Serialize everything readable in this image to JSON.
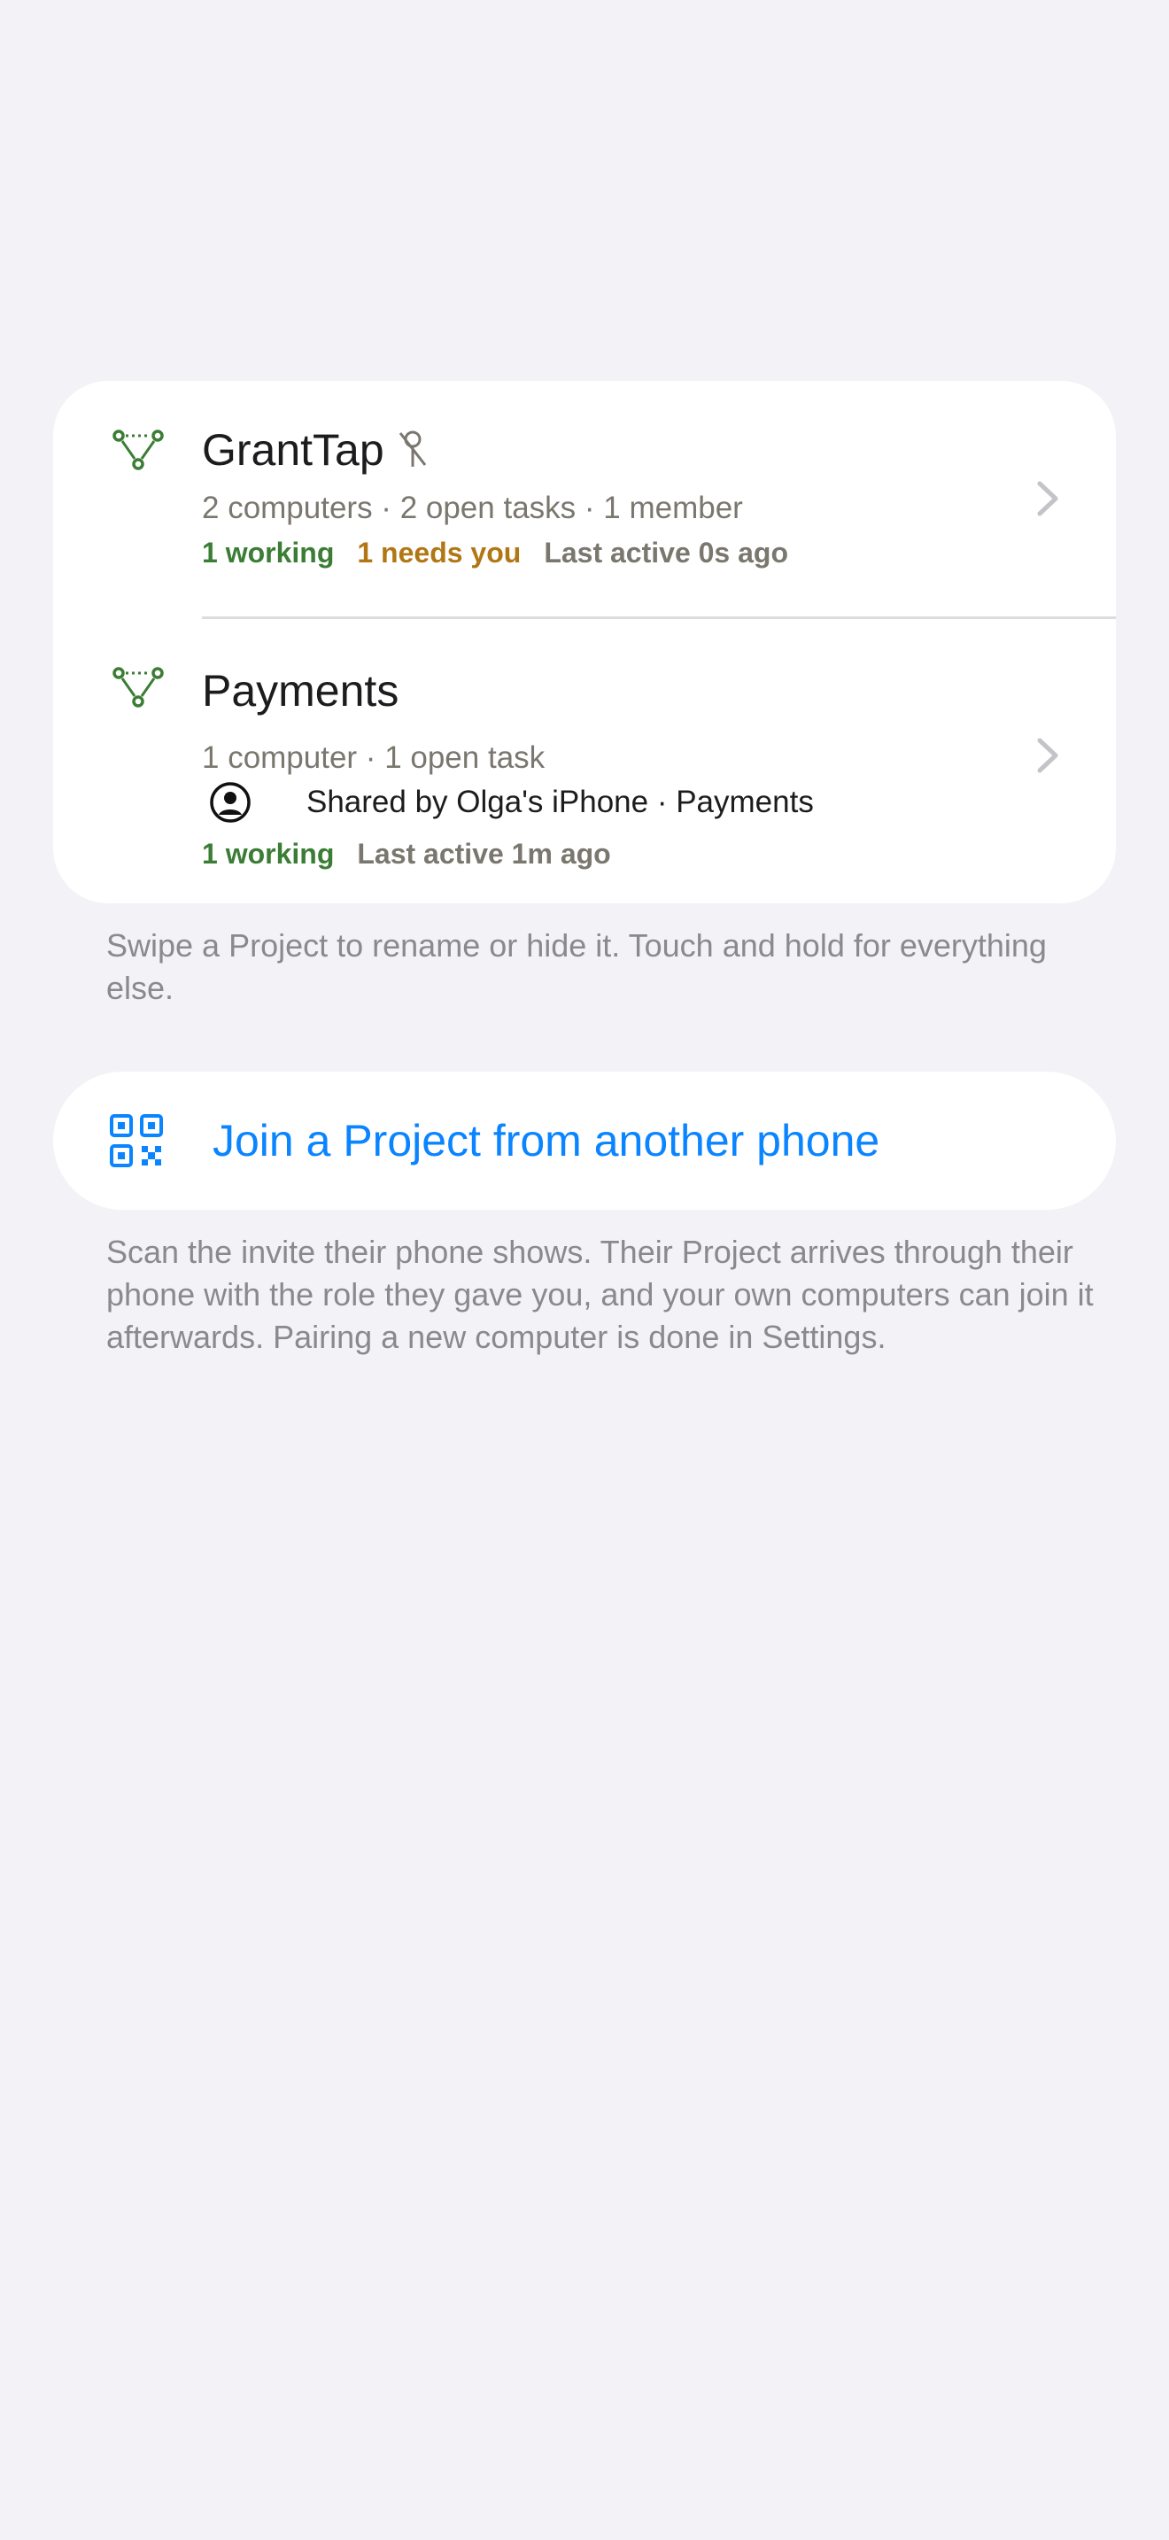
{
  "projects": [
    {
      "title": "GrantTap",
      "meta": "2 computers · 2 open tasks · 1 member",
      "status_working": "1 working",
      "status_needs": "1 needs you",
      "last_active": "Last active 0s ago",
      "icon": "project-network-icon",
      "pinned_icon": "pin-slash-icon"
    },
    {
      "title": "Payments",
      "meta": "1 computer · 1 open task",
      "shared": "Shared by Olga's iPhone · Payments",
      "status_working": "1 working",
      "last_active": "Last active 1m ago",
      "icon": "project-network-icon"
    }
  ],
  "projects_footnote": "Swipe a Project to rename or hide it. Touch and hold for everything else.",
  "join": {
    "label": "Join a Project from another phone",
    "icon": "qr-code-icon"
  },
  "join_footnote": "Scan the invite their phone shows. Their Project arrives through their phone with the role they gave you, and your own computers can join it afterwards. Pairing a new computer is done in Settings.",
  "colors": {
    "background": "#f2f2f7",
    "accent": "#0a84ff",
    "working": "#3b7d35",
    "needs_you": "#b07714",
    "secondary_text": "#7a776f"
  }
}
